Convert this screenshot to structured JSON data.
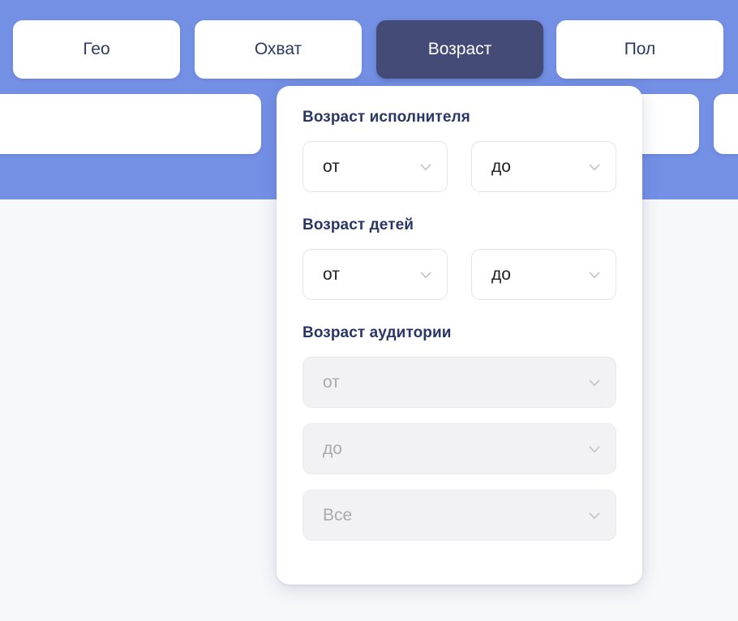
{
  "theme": {
    "band_color": "#7490E5",
    "active_tab_color": "#444B77",
    "heading_color": "#2A3766",
    "page_background": "#F7F8FA",
    "disabled_field_color": "#F2F2F4"
  },
  "tabs": [
    {
      "label": "Гео",
      "active": false
    },
    {
      "label": "Охват",
      "active": false
    },
    {
      "label": "Возраст",
      "active": true
    },
    {
      "label": "Пол",
      "active": false
    }
  ],
  "panel": {
    "groups": [
      {
        "title": "Возраст исполнителя",
        "fields": [
          {
            "value": "от",
            "disabled": false,
            "icon": "chevron-down-icon"
          },
          {
            "value": "до",
            "disabled": false,
            "icon": "chevron-down-icon"
          }
        ]
      },
      {
        "title": "Возраст детей",
        "fields": [
          {
            "value": "от",
            "disabled": false,
            "icon": "chevron-down-icon"
          },
          {
            "value": "до",
            "disabled": false,
            "icon": "chevron-down-icon"
          }
        ]
      },
      {
        "title": "Возраст аудитории",
        "fields": [
          {
            "value": "от",
            "disabled": true,
            "icon": "chevron-down-icon"
          },
          {
            "value": "до",
            "disabled": true,
            "icon": "chevron-down-icon"
          },
          {
            "value": "Все",
            "disabled": true,
            "icon": "chevron-down-icon"
          }
        ]
      }
    ]
  }
}
